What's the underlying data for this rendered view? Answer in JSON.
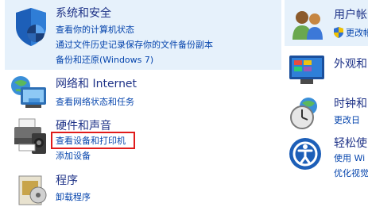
{
  "left_column": [
    {
      "title": "系统和安全",
      "icon": "shield-icon",
      "links": [
        "查看你的计算机状态",
        "通过文件历史记录保存你的文件备份副本",
        "备份和还原(Windows 7)"
      ]
    },
    {
      "title": "网络和 Internet",
      "icon": "network-icon",
      "links": [
        "查看网络状态和任务"
      ]
    },
    {
      "title": "硬件和声音",
      "icon": "printer-icon",
      "links": [
        "查看设备和打印机",
        "添加设备"
      ]
    },
    {
      "title": "程序",
      "icon": "programs-icon",
      "links": [
        "卸载程序"
      ]
    }
  ],
  "right_column": [
    {
      "title": "用户帐",
      "icon": "users-icon",
      "links": [
        "更改帐"
      ]
    },
    {
      "title": "外观和",
      "icon": "appearance-icon",
      "links": []
    },
    {
      "title": "时钟和",
      "icon": "clock-icon",
      "links": [
        "更改日"
      ]
    },
    {
      "title": "轻松使",
      "icon": "ease-of-access-icon",
      "links": [
        "使用 Wi",
        "优化视觉"
      ]
    }
  ],
  "highlighted_link": "查看设备和打印机",
  "colors": {
    "title": "#1e3287",
    "link": "#0645ad",
    "highlight": "#e01b1b",
    "selected_bg": "#e6f1fb"
  }
}
